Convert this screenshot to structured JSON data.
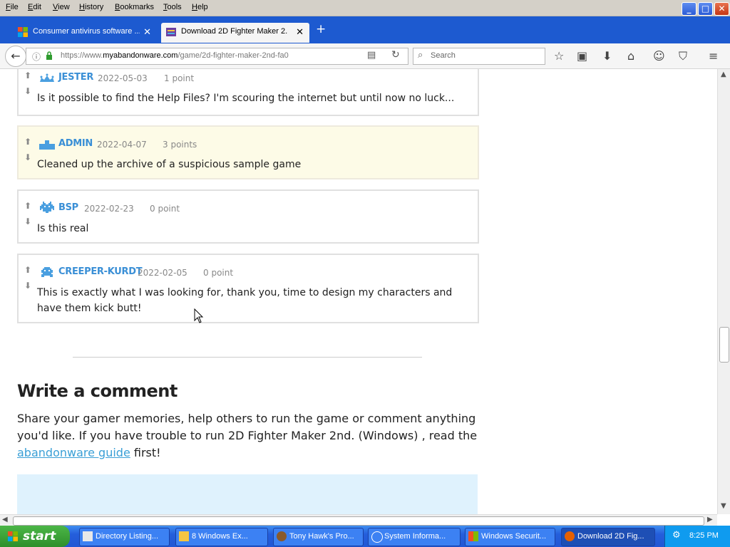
{
  "menu": [
    "File",
    "Edit",
    "View",
    "History",
    "Bookmarks",
    "Tools",
    "Help"
  ],
  "tabs": [
    {
      "label": "Consumer antivirus software ..."
    },
    {
      "label": "Download 2D Fighter Maker 2..."
    }
  ],
  "nav": {
    "url_prefix": "https://www.",
    "url_domain": "myabandonware.com",
    "url_path": "/game/2d-fighter-maker-2nd-fa0",
    "search_placeholder": "Search"
  },
  "comments": [
    {
      "user": "JESTER",
      "date": "2022-05-03",
      "points": "1 point",
      "text": "Is it possible to find the Help Files? I'm scouring the internet but until now no luck..."
    },
    {
      "user": "ADMIN",
      "date": "2022-04-07",
      "points": "3 points",
      "text": "Cleaned up the archive of a suspicious sample game"
    },
    {
      "user": "BSP",
      "date": "2022-02-23",
      "points": "0 point",
      "text": "Is this real"
    },
    {
      "user": "CREEPER-KURDT",
      "date": "2022-02-05",
      "points": "0 point",
      "text": "This is exactly what I was looking for, thank you, time to design my characters and have them kick butt!"
    }
  ],
  "write": {
    "heading": "Write a comment",
    "desc_before": "Share your gamer memories, help others to run the game or comment anything you'd like. If you have trouble to run 2D Fighter Maker 2nd. (Windows) , read the ",
    "link": "abandonware guide",
    "desc_after": " first!"
  },
  "taskbar": {
    "start": "start",
    "tasks": [
      "Directory Listing...",
      "8 Windows Ex...",
      "Tony Hawk's Pro...",
      "System Informa...",
      "Windows Securit...",
      "Download 2D Fig..."
    ],
    "clock": "8:25 PM"
  },
  "colors": {
    "accent": "#3a8fd6",
    "admin_bg": "#fdfbe7",
    "xp_blue": "#245edb",
    "start_green": "#3da33a"
  }
}
